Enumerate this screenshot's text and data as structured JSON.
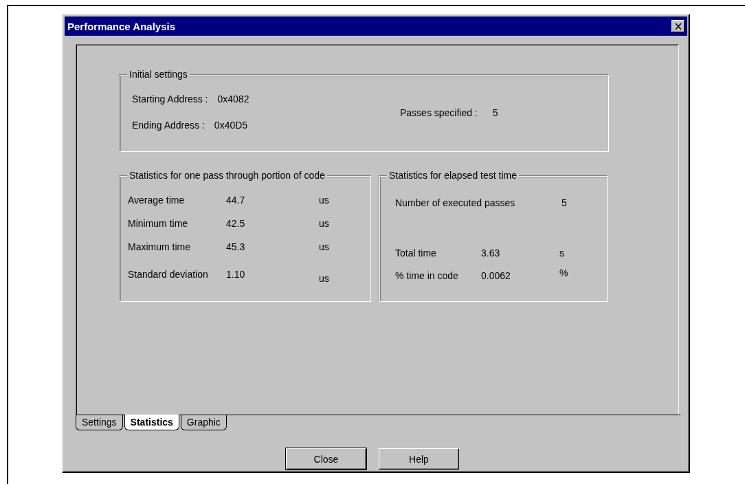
{
  "window": {
    "title": "Performance Analysis"
  },
  "initial_settings": {
    "title": "Initial settings",
    "rows": [
      {
        "label": "Starting Address :",
        "value": "0x4082"
      },
      {
        "label": "Ending Address :",
        "value": "0x40D5"
      }
    ],
    "passes": {
      "label": "Passes specified :",
      "value": "5"
    }
  },
  "pass_stats": {
    "title": "Statistics for one pass through portion of code",
    "rows": [
      {
        "label": "Average time",
        "value": "44.7",
        "unit": "us"
      },
      {
        "label": "Minimum time",
        "value": "42.5",
        "unit": "us"
      },
      {
        "label": "Maximum time",
        "value": "45.3",
        "unit": "us"
      },
      {
        "label": "Standard deviation",
        "value": "1.10",
        "unit": "us"
      }
    ]
  },
  "elapsed_stats": {
    "title": "Statistics for elapsed test time",
    "passes": {
      "label": "Number of executed passes",
      "value": "5"
    },
    "rows": [
      {
        "label": "Total time",
        "value": "3.63",
        "unit": "s"
      },
      {
        "label": "% time in code",
        "value": "0.0062",
        "unit": "%"
      }
    ]
  },
  "tabs": [
    {
      "label": "Settings",
      "selected": false
    },
    {
      "label": "Statistics",
      "selected": true
    },
    {
      "label": "Graphic",
      "selected": false
    }
  ],
  "buttons": [
    "Close",
    "Help"
  ]
}
